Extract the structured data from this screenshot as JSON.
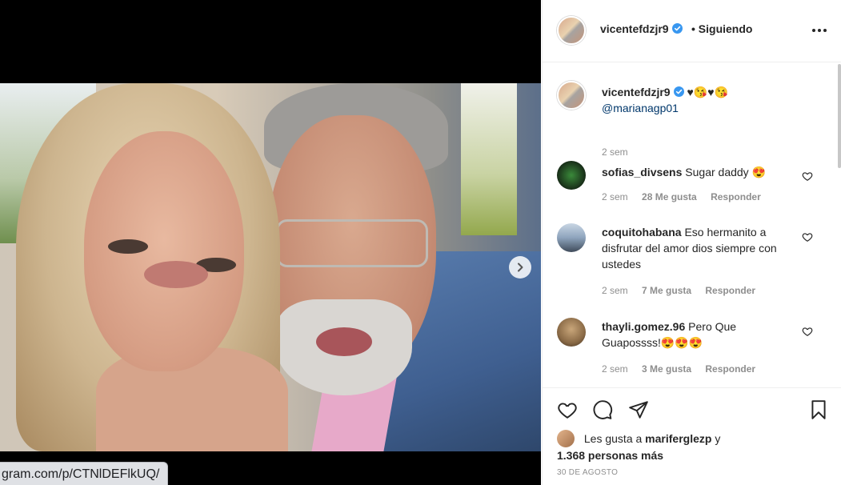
{
  "browser": {
    "url_fragment": "gram.com/p/CTNlDEFlkUQ/"
  },
  "post": {
    "author": "vicentefdzjr9",
    "following_label": "• Siguiendo",
    "caption_emojis": "♥😘♥😘",
    "caption_mention": "@marianagp01",
    "caption_time": "2 sem",
    "likes_prefix": "Les gusta a",
    "likes_user": "mariferglezp",
    "likes_joiner": "y",
    "likes_count": "1.368 personas más",
    "date": "30 DE AGOSTO"
  },
  "comments": [
    {
      "user": "sofias_divsens",
      "text": "Sugar daddy 😍",
      "time": "2 sem",
      "likes": "28 Me gusta",
      "reply": "Responder"
    },
    {
      "user": "coquitohabana",
      "text": "Eso hermanito a disfrutar del amor dios siempre con ustedes",
      "time": "2 sem",
      "likes": "7 Me gusta",
      "reply": "Responder"
    },
    {
      "user": "thayli.gomez.96",
      "text": "Pero Que Guapossss!😍😍😍",
      "time": "2 sem",
      "likes": "3 Me gusta",
      "reply": "Responder"
    }
  ],
  "icons": {
    "verified": "verified-badge-icon",
    "more": "more-options-icon",
    "next": "chevron-right-icon",
    "like": "heart-icon",
    "comment": "comment-bubble-icon",
    "share": "paper-plane-icon",
    "save": "bookmark-icon"
  },
  "colors": {
    "verified": "#3897f0",
    "link": "#00376b",
    "muted": "#8e8e8e",
    "text": "#262626"
  }
}
